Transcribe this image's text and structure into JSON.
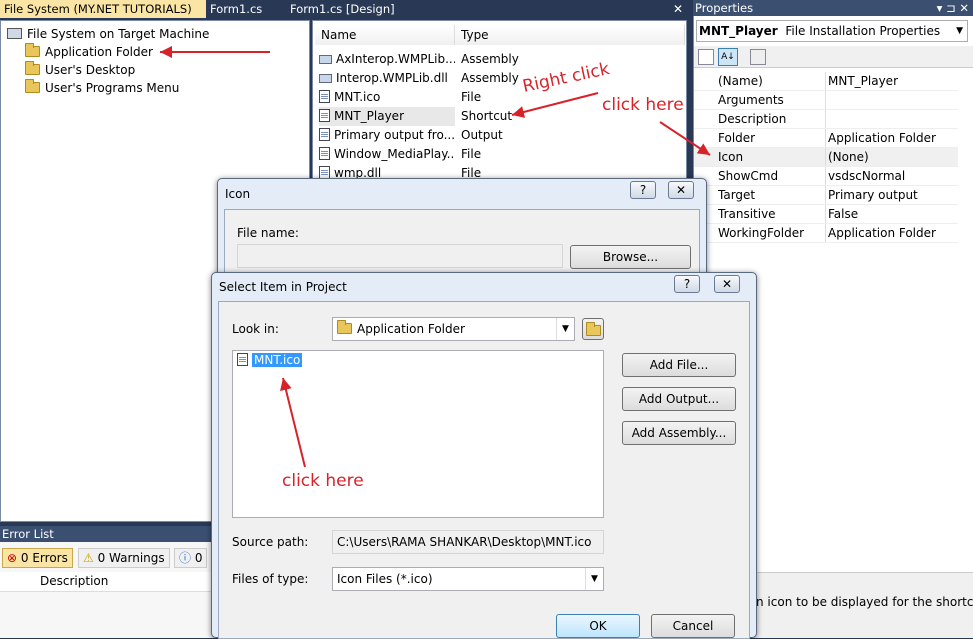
{
  "tabs": [
    {
      "label": "File System (MY.NET TUTORIALS)",
      "active": true
    },
    {
      "label": "Form1.cs",
      "active": false
    },
    {
      "label": "Form1.cs [Design]",
      "active": false
    }
  ],
  "tab_close_glyph": "✕",
  "tree": {
    "root": "File System on Target Machine",
    "items": [
      "Application Folder",
      "User's Desktop",
      "User's Programs Menu"
    ]
  },
  "file_list": {
    "columns": [
      "Name",
      "Type"
    ],
    "rows": [
      {
        "name": "AxInterop.WMPLib....",
        "type": "Assembly"
      },
      {
        "name": "Interop.WMPLib.dll",
        "type": "Assembly"
      },
      {
        "name": "MNT.ico",
        "type": "File"
      },
      {
        "name": "MNT_Player",
        "type": "Shortcut"
      },
      {
        "name": "Primary output fro...",
        "type": "Output"
      },
      {
        "name": "Window_MediaPlay...",
        "type": "File"
      },
      {
        "name": "wmp.dll",
        "type": "File"
      }
    ]
  },
  "properties": {
    "title": "Properties",
    "title_controls": "▾ ⊐ ✕",
    "object_name": "MNT_Player",
    "object_type": "File Installation Properties",
    "rows": [
      {
        "key": "(Name)",
        "value": "MNT_Player"
      },
      {
        "key": "Arguments",
        "value": ""
      },
      {
        "key": "Description",
        "value": ""
      },
      {
        "key": "Folder",
        "value": "Application Folder"
      },
      {
        "key": "Icon",
        "value": "(None)"
      },
      {
        "key": "ShowCmd",
        "value": "vsdscNormal"
      },
      {
        "key": "Target",
        "value": "Primary output"
      },
      {
        "key": "Transitive",
        "value": "False"
      },
      {
        "key": "WorkingFolder",
        "value": "Application Folder"
      }
    ],
    "description_text": "n icon to be displayed for the shortcut"
  },
  "error_list": {
    "title": "Error List",
    "errors": "0 Errors",
    "warnings": "0 Warnings",
    "messages": "0",
    "column": "Description"
  },
  "icon_dialog": {
    "title": "Icon",
    "help": "?",
    "close": "✕",
    "file_name_label": "File name:",
    "file_name_value": "",
    "browse": "Browse..."
  },
  "select_dialog": {
    "title": "Select Item in Project",
    "help": "?",
    "close": "✕",
    "look_in_label": "Look in:",
    "look_in_value": "Application Folder",
    "items": [
      "MNT.ico"
    ],
    "buttons": [
      "Add File...",
      "Add Output...",
      "Add Assembly..."
    ],
    "source_path_label": "Source path:",
    "source_path_value": "C:\\Users\\RAMA SHANKAR\\Desktop\\MNT.ico",
    "files_of_type_label": "Files of type:",
    "files_of_type_value": "Icon Files (*.ico)",
    "ok": "OK",
    "cancel": "Cancel"
  },
  "annotations": {
    "right_click": "Right click",
    "click_here_1": "click here",
    "click_here_2": "click here",
    "color": "#d8222a"
  }
}
